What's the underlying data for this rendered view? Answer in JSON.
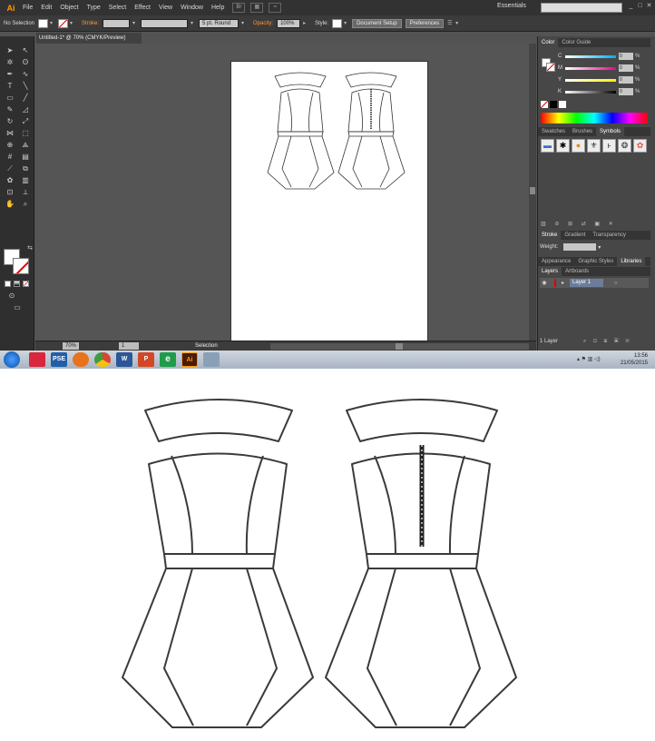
{
  "app": {
    "logo": "Ai",
    "menu": [
      "File",
      "Edit",
      "Object",
      "Type",
      "Select",
      "Effect",
      "View",
      "Window",
      "Help"
    ],
    "workspace": "Essentials",
    "window_controls": [
      "_",
      "□",
      "✕"
    ]
  },
  "control_bar": {
    "selection_label": "No Selection",
    "stroke_label": "Stroke:",
    "brush_value": "5 pt. Round",
    "opacity_label": "Opacity:",
    "opacity_value": "100%",
    "style_label": "Style:",
    "document_setup": "Document Setup",
    "preferences": "Preferences"
  },
  "document": {
    "tab_title": "Untitled-1* @ 70% (CMYK/Preview)",
    "zoom": "70%",
    "page": "1",
    "status": "Selection"
  },
  "panels": {
    "color_tabs": [
      "Color",
      "Color Guide"
    ],
    "channels": [
      {
        "label": "C",
        "value": "0",
        "color": "#00aeef"
      },
      {
        "label": "M",
        "value": "0",
        "color": "#ec008c"
      },
      {
        "label": "Y",
        "value": "0",
        "color": "#fff200"
      },
      {
        "label": "K",
        "value": "0",
        "color": "#000000"
      }
    ],
    "percent": "%",
    "swatch_tabs": [
      "Swatches",
      "Brushes",
      "Symbols"
    ],
    "stroke_tabs": [
      "Stroke",
      "Gradient",
      "Transparency"
    ],
    "weight_label": "Weight:",
    "appearance_tabs": [
      "Appearance",
      "Graphic Styles",
      "Libraries"
    ],
    "layers_tabs": [
      "Layers",
      "Artboards"
    ],
    "layer_name": "Layer 1",
    "layers_count": "1 Layer"
  },
  "taskbar": {
    "apps": [
      {
        "label": "",
        "color": "#d7263d"
      },
      {
        "label": "PSE",
        "color": "#1f5fa8"
      },
      {
        "label": "",
        "color": "#e8731b"
      },
      {
        "label": "",
        "color": "#3d9c40"
      },
      {
        "label": "W",
        "color": "#2b5797"
      },
      {
        "label": "P",
        "color": "#d24726"
      },
      {
        "label": "e",
        "color": "#1e9c4a"
      },
      {
        "label": "Ai",
        "color": "#4a1c07"
      },
      {
        "label": "",
        "color": "#8aa0b8"
      }
    ],
    "time": "13:56",
    "date": "21/05/2015"
  }
}
